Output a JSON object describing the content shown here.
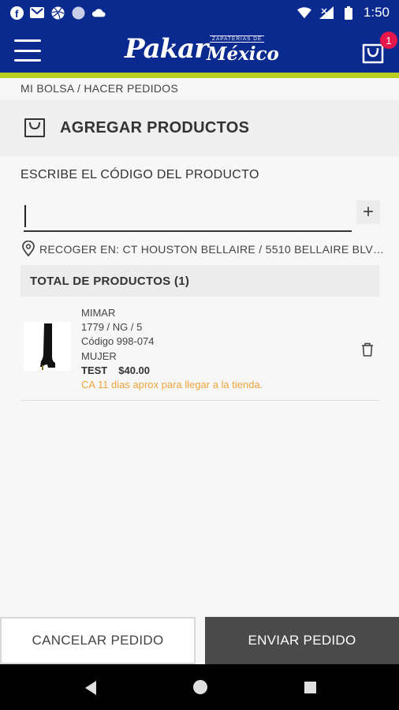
{
  "status_bar": {
    "time": "1:50",
    "notification_icons": [
      "facebook-icon",
      "gmail-icon",
      "dribbble-icon",
      "circle-icon",
      "cloud-icon"
    ],
    "system_icons": [
      "wifi-icon",
      "signal-icon",
      "battery-icon"
    ]
  },
  "header": {
    "brand": "Pakar",
    "country": "México",
    "tagline": "ZAPATERIAS DE",
    "cart_count": "1",
    "colors": {
      "bar": "#0b2a8f",
      "accent": "#b8cf22",
      "badge": "#e8174b"
    }
  },
  "breadcrumb": "MI BOLSA / HACER PEDIDOS",
  "section": {
    "title": "AGREGAR PRODUCTOS"
  },
  "product_code": {
    "label": "ESCRIBE EL CÓDIGO DEL PRODUCTO",
    "value": "",
    "add_label": "+"
  },
  "pickup": {
    "text": "RECOGER EN: CT HOUSTON BELLAIRE / 5510 BELLAIRE BLVD..."
  },
  "totals": {
    "label": "TOTAL DE PRODUCTOS (1)"
  },
  "items": [
    {
      "name": "MIMAR",
      "variant": "1779 / NG / 5",
      "code": "Código 998-074",
      "category": "MUJER",
      "tag": "TEST",
      "price": "$40.00",
      "eta": "CA 11 dias aprox para llegar a la tienda.",
      "eta_color": "#f0a33a"
    }
  ],
  "footer": {
    "cancel_label": "CANCELAR PEDIDO",
    "send_label": "ENVIAR PEDIDO"
  }
}
